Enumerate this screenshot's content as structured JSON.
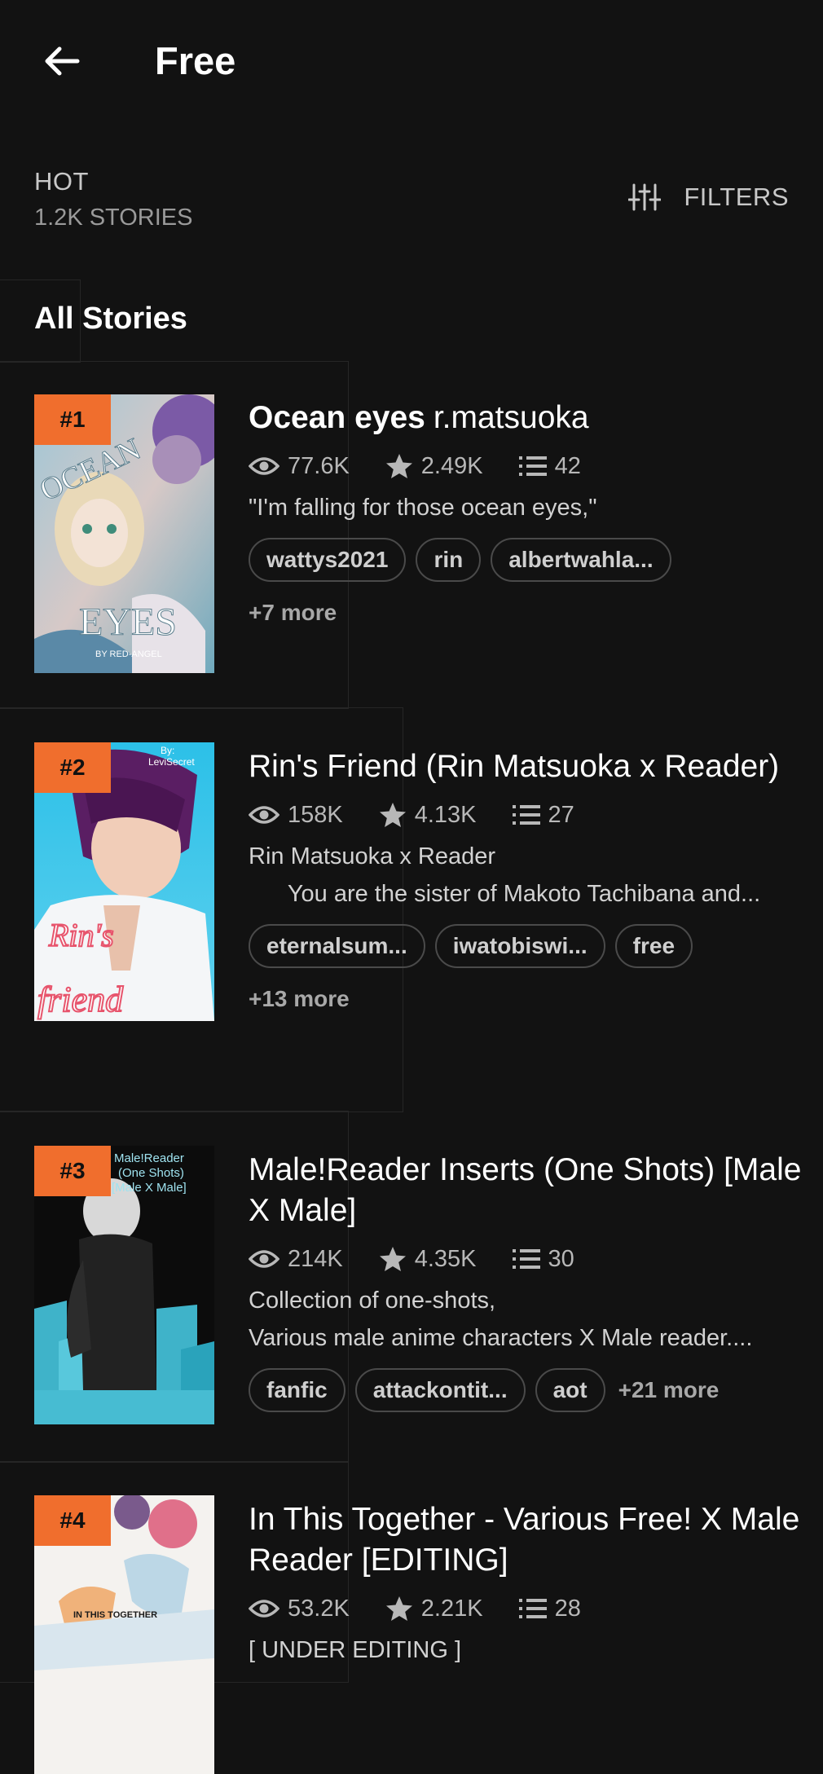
{
  "appbar": {
    "title": "Free",
    "back_icon": "arrow-left-icon"
  },
  "list_header": {
    "sort_label": "HOT",
    "count_label": "1.2K STORIES",
    "filters_label": "FILTERS",
    "filters_icon": "sliders-icon"
  },
  "section": {
    "title": "All Stories"
  },
  "colors": {
    "background": "#121212",
    "rank_badge": "#f06e2d",
    "tag_border": "#4a4a4a"
  },
  "stories": [
    {
      "rank": "#1",
      "title": "Ocean eyes",
      "author": "r.matsuoka",
      "reads": "77.6K",
      "votes": "2.49K",
      "parts": "42",
      "description": "\"I'm falling for those ocean eyes,\"",
      "tags": [
        "wattys2021",
        "rin",
        "albertwahla..."
      ],
      "more": "+7 more"
    },
    {
      "rank": "#2",
      "title": "Rin's Friend (Rin Matsuoka x Reader)",
      "reads": "158K",
      "votes": "4.13K",
      "parts": "27",
      "description": "Rin Matsuoka x Reader\n      You are the sister of Makoto Tachibana and...",
      "tags": [
        "eternalsum...",
        "iwatobiswi...",
        "free"
      ],
      "more": "+13 more"
    },
    {
      "rank": "#3",
      "title": "Male!Reader Inserts (One Shots) [Male X Male]",
      "reads": "214K",
      "votes": "4.35K",
      "parts": "30",
      "description": "Collection of one-shots,\nVarious male anime characters X Male reader....",
      "tags": [
        "fanfic",
        "attackontit...",
        "aot"
      ],
      "more": "+21 more"
    },
    {
      "rank": "#4",
      "title": "In This Together - Various Free! X Male Reader [EDITING]",
      "reads": "53.2K",
      "votes": "2.21K",
      "parts": "28",
      "description": "[ UNDER EDITING ]"
    }
  ],
  "covers": [
    {
      "text_lines": [
        "OCEAN",
        "EYES",
        "BY RED-ANGEL"
      ]
    },
    {
      "byline": "By:",
      "author": "LeviSecret",
      "text_lines": [
        "Rin's",
        "friend"
      ]
    },
    {
      "text_lines": [
        "Male!Reader",
        "(One Shots)",
        "[Male X Male]"
      ]
    },
    {
      "text_lines": [
        "IN THIS TOGETHER"
      ]
    }
  ]
}
